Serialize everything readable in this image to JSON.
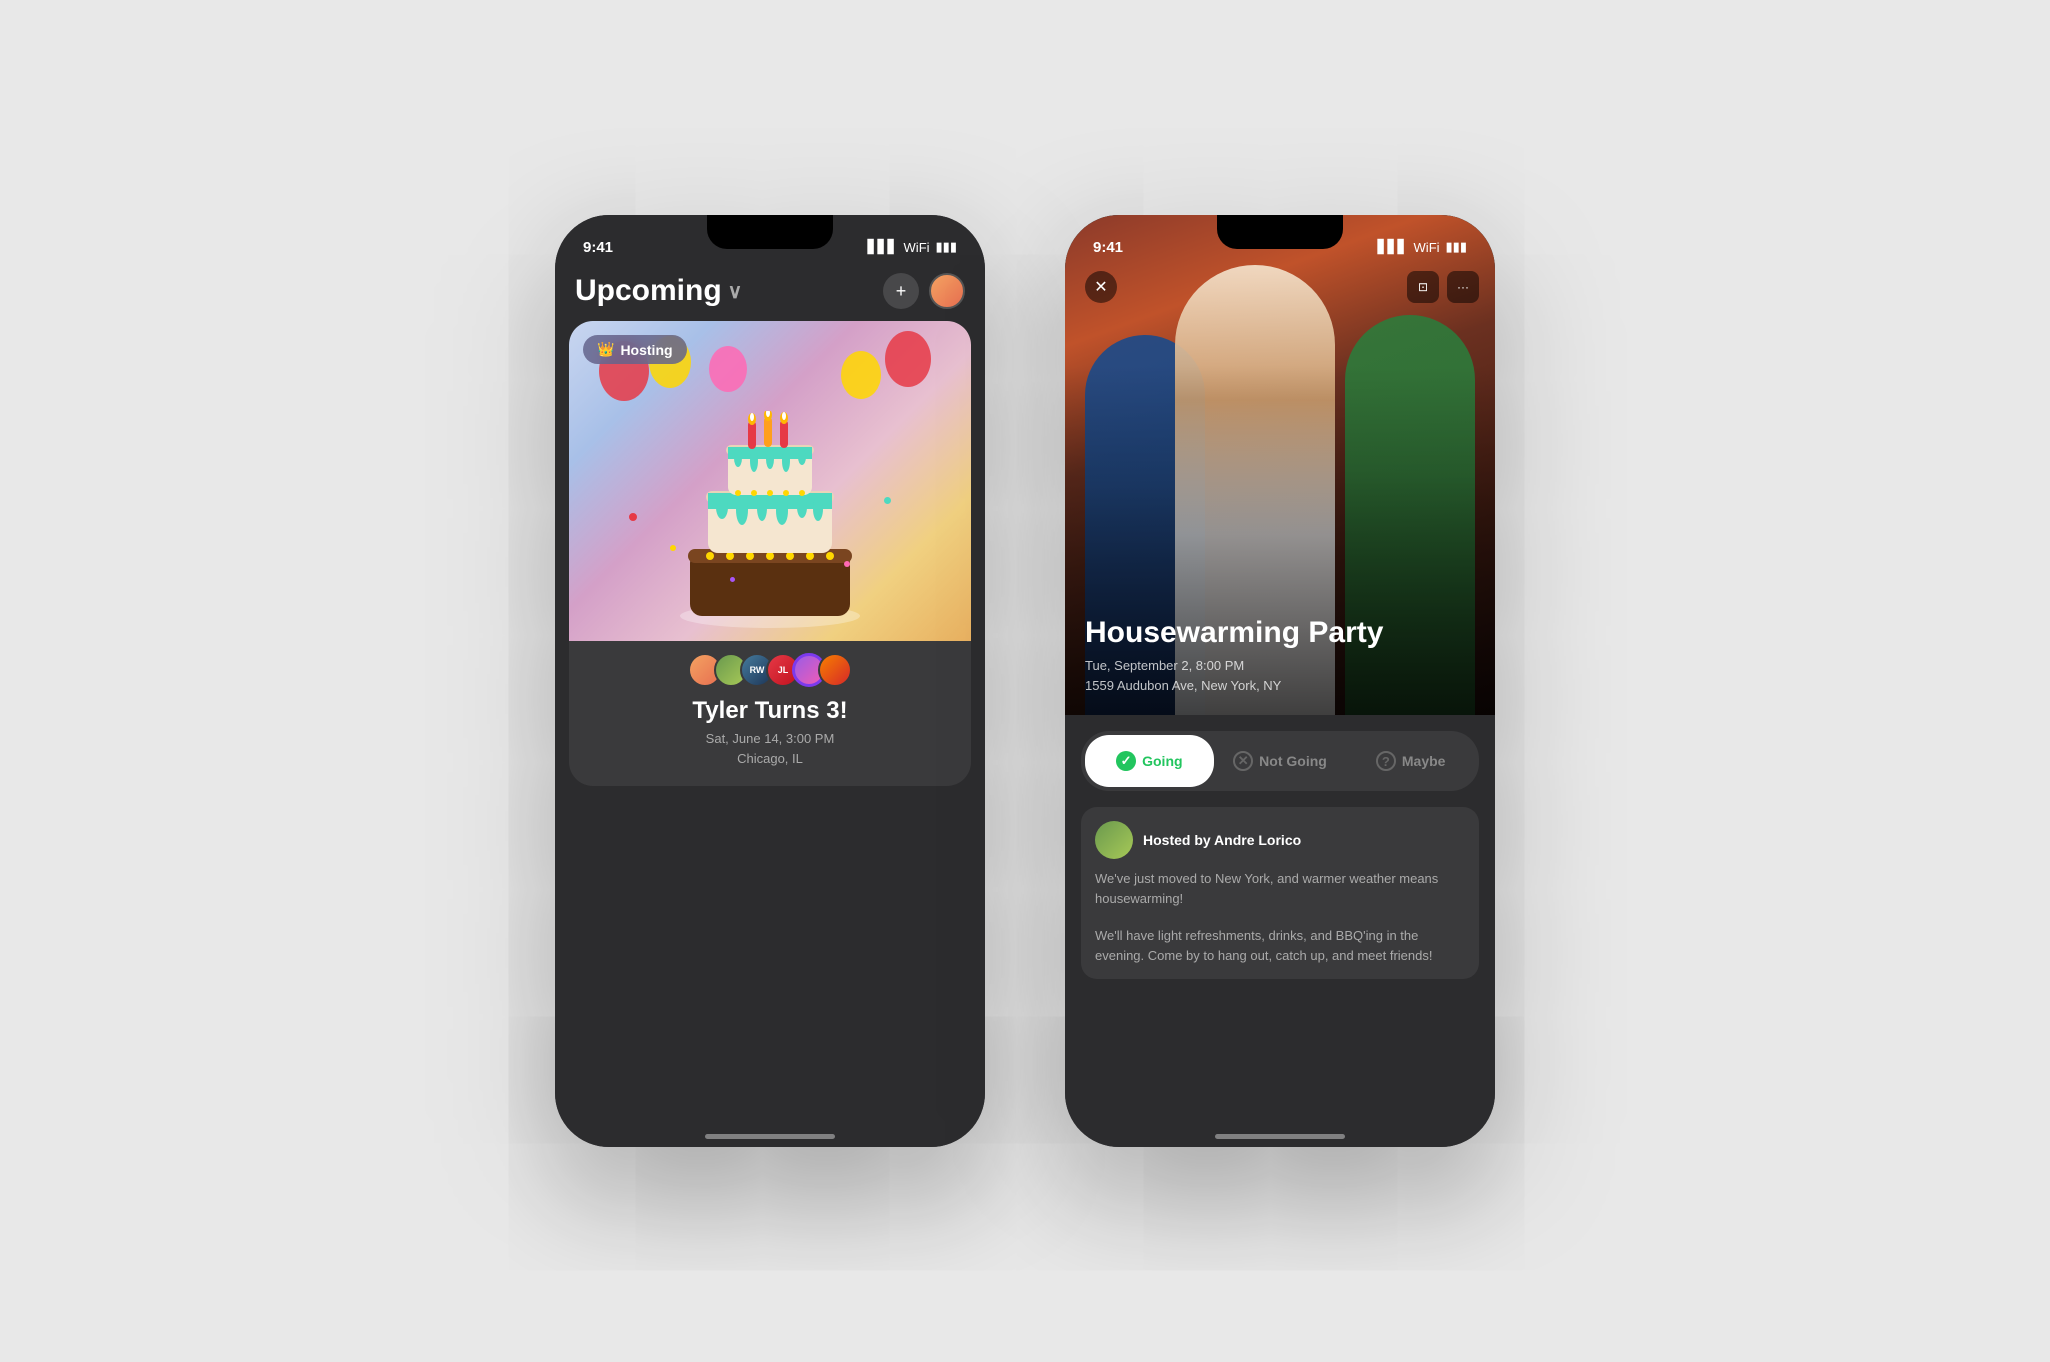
{
  "page": {
    "bg_color": "#e8e8e8"
  },
  "phone1": {
    "status_time": "9:41",
    "header_title": "Upcoming",
    "header_chevron": "›",
    "btn_add": "+",
    "event": {
      "hosting_label": "Hosting",
      "name": "Tyler Turns 3!",
      "date_line": "Sat, June 14, 3:00 PM",
      "location": "Chicago, IL"
    },
    "attendees": [
      "RW",
      "JL",
      "",
      "",
      "",
      ""
    ]
  },
  "phone2": {
    "status_time": "9:41",
    "event_title": "Housewarming Party",
    "event_date": "Tue, September 2, 8:00 PM",
    "event_address": "1559 Audubon Ave, New York, NY",
    "rsvp": {
      "going_label": "Going",
      "not_going_label": "Not Going",
      "maybe_label": "Maybe"
    },
    "host": {
      "hosted_by": "Hosted by Andre Lorico",
      "desc1": "We've just moved to New York, and warmer weather means housewarming!",
      "desc2": "We'll have light refreshments, drinks, and BBQ'ing in the evening. Come by to hang out, catch up, and meet friends!"
    }
  }
}
